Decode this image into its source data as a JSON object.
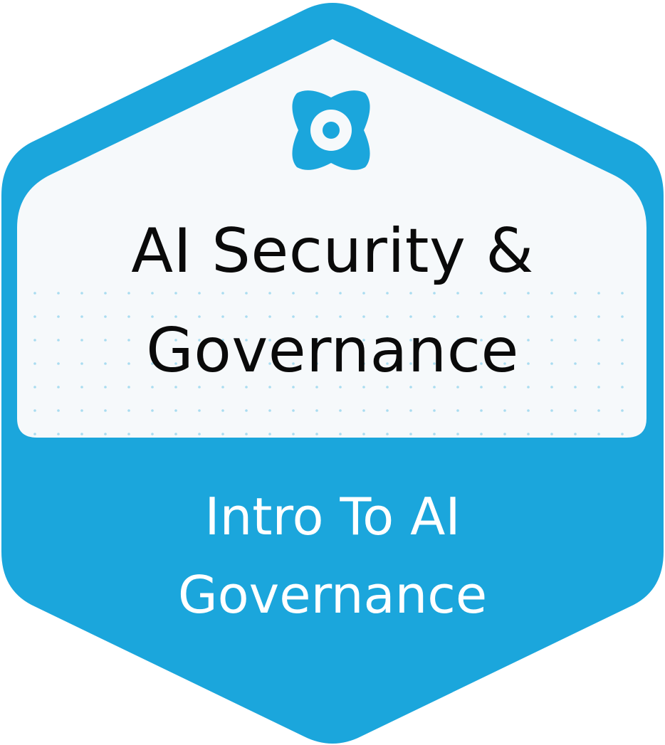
{
  "badge": {
    "title_line_1": "AI Security &",
    "title_line_2": "Governance",
    "subtitle_line_1": "Intro To AI",
    "subtitle_line_2": "Governance",
    "colors": {
      "brand_blue": "#1ba6dc",
      "panel_white": "#f6f9fb",
      "dot_blue": "#1ba6dc",
      "title_text": "#0a0a0a",
      "subtitle_text": "#ffffff"
    },
    "logo_icon": "four-point-star-ring-icon"
  }
}
